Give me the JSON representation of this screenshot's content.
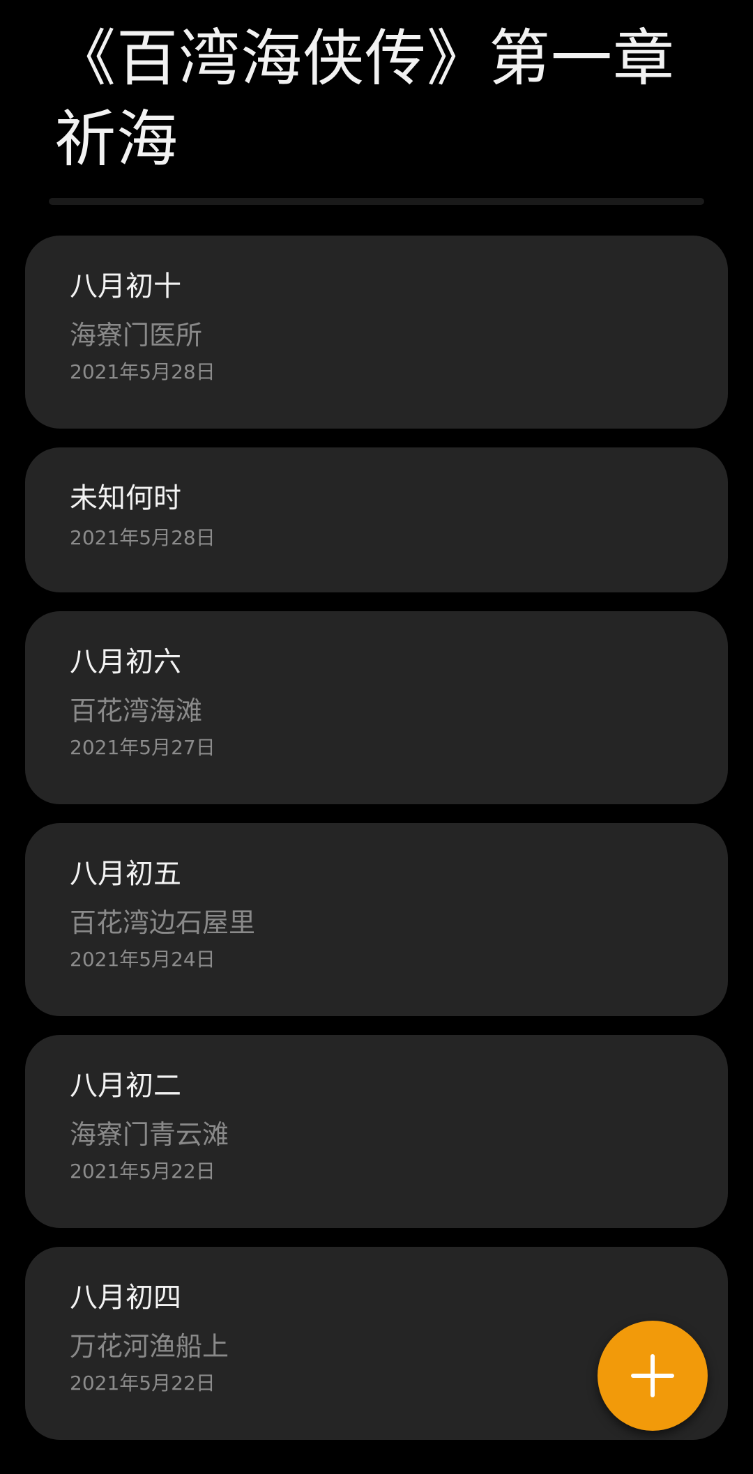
{
  "header": {
    "title": "《百湾海侠传》第一章 祈海"
  },
  "notes": [
    {
      "title": "八月初十",
      "subtitle": "海寮门医所",
      "date": "2021年5月28日"
    },
    {
      "title": "未知何时",
      "subtitle": "",
      "date": "2021年5月28日"
    },
    {
      "title": "八月初六",
      "subtitle": "百花湾海滩",
      "date": "2021年5月27日"
    },
    {
      "title": "八月初五",
      "subtitle": "百花湾边石屋里",
      "date": "2021年5月24日"
    },
    {
      "title": "八月初二",
      "subtitle": "海寮门青云滩",
      "date": "2021年5月22日"
    },
    {
      "title": "八月初四",
      "subtitle": "万花河渔船上",
      "date": "2021年5月22日"
    }
  ],
  "fab": {
    "icon": "plus-icon",
    "color": "#f29a0a"
  },
  "colors": {
    "background": "#000000",
    "card": "#252525",
    "accent": "#f29a0a"
  }
}
